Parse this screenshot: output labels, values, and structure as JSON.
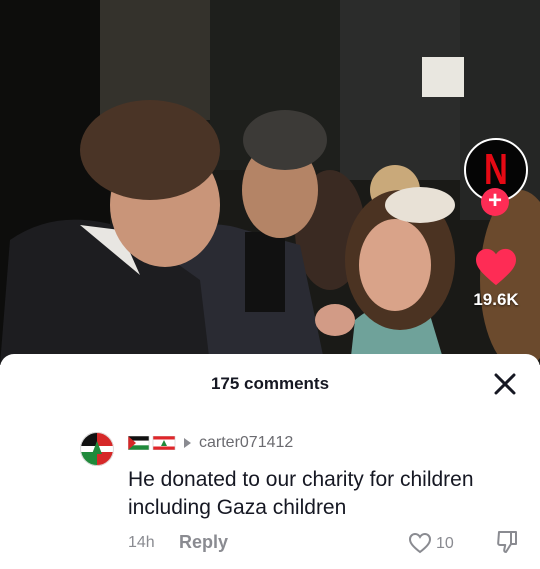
{
  "video": {
    "creator_icon": "netflix-n-logo",
    "follow_icon": "plus-icon",
    "like_icon": "heart-filled-icon",
    "like_count": "19.6K",
    "brand_color": "#e50914",
    "accent_color": "#fe2c55"
  },
  "comments_sheet": {
    "title": "175 comments",
    "close_icon": "close-icon",
    "comments": [
      {
        "avatar_icon": "palestine-lebanon-flag-avatar",
        "username_flags": [
          "palestine-flag",
          "lebanon-flag"
        ],
        "username": "carter071412",
        "text": "He donated to our charity for children including Gaza children",
        "time": "14h",
        "reply_label": "Reply",
        "likes": "10"
      }
    ]
  }
}
